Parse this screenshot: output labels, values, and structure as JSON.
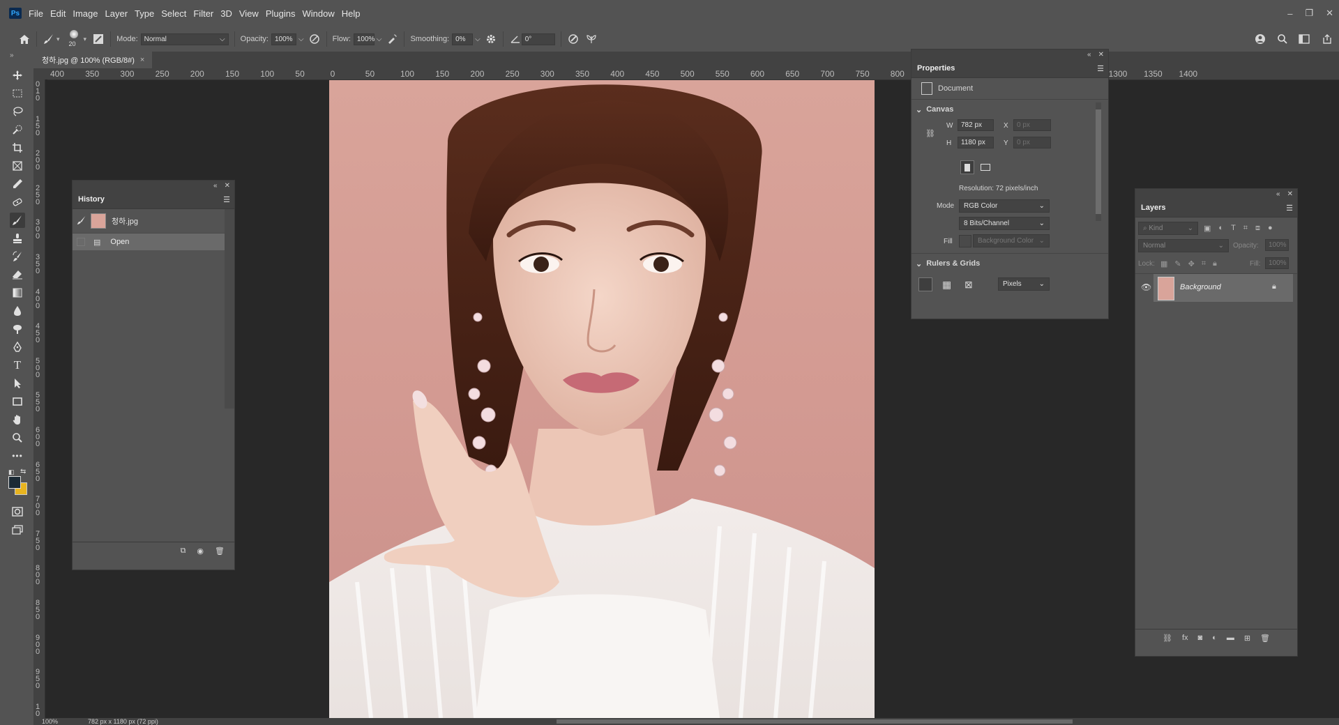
{
  "menubar": {
    "logo": "Ps",
    "items": [
      "File",
      "Edit",
      "Image",
      "Layer",
      "Type",
      "Select",
      "Filter",
      "3D",
      "View",
      "Plugins",
      "Window",
      "Help"
    ],
    "window_controls": [
      "–",
      "❐",
      "✕"
    ]
  },
  "options": {
    "brush_size": "20",
    "mode_label": "Mode:",
    "mode_value": "Normal",
    "opacity_label": "Opacity:",
    "opacity_value": "100%",
    "flow_label": "Flow:",
    "flow_value": "100%",
    "smoothing_label": "Smoothing:",
    "smoothing_value": "0%",
    "angle_value": "0°"
  },
  "document": {
    "tab_title": "청하.jpg @ 100% (RGB/8#)",
    "tab_close": "×"
  },
  "ruler_top": [
    "400",
    "350",
    "300",
    "250",
    "200",
    "150",
    "100",
    "50",
    "0",
    "50",
    "100",
    "150",
    "200",
    "250",
    "300",
    "350",
    "400",
    "450",
    "500",
    "550",
    "600",
    "650",
    "700",
    "750",
    "800",
    "00",
    "1150",
    "1200",
    "1250",
    "1300",
    "1350",
    "1400"
  ],
  "ruler_left": [
    "0",
    "1",
    "0",
    "1",
    "5",
    "0",
    "2",
    "0",
    "0",
    "2",
    "5",
    "0",
    "3",
    "0",
    "0",
    "3",
    "5",
    "0",
    "4",
    "0",
    "0",
    "4",
    "5",
    "0",
    "5",
    "0",
    "0",
    "5",
    "5",
    "0",
    "6",
    "0",
    "0",
    "6",
    "5",
    "0",
    "7",
    "0",
    "0",
    "7",
    "5",
    "0",
    "8",
    "0",
    "0",
    "8",
    "5",
    "0",
    "9",
    "0",
    "0",
    "9",
    "5",
    "0",
    "1",
    "0"
  ],
  "history": {
    "title": "History",
    "snapshot_name": "청하.jpg",
    "steps": [
      "Open"
    ]
  },
  "properties": {
    "title": "Properties",
    "doc_label": "Document",
    "canvas_header": "Canvas",
    "w_label": "W",
    "w_value": "782 px",
    "h_label": "H",
    "h_value": "1180 px",
    "x_label": "X",
    "x_value": "0 px",
    "y_label": "Y",
    "y_value": "0 px",
    "resolution": "Resolution: 72 pixels/inch",
    "mode_label": "Mode",
    "mode_value": "RGB Color",
    "bits_value": "8 Bits/Channel",
    "fill_label": "Fill",
    "fill_value": "Background Color",
    "rulers_header": "Rulers & Grids",
    "units_value": "Pixels"
  },
  "layers": {
    "title": "Layers",
    "filter_placeholder": "Kind",
    "blend_mode": "Normal",
    "opacity_label": "Opacity:",
    "opacity_value": "100%",
    "lock_label": "Lock:",
    "fill_label": "Fill:",
    "fill_value": "100%",
    "layer_name": "Background"
  },
  "status": {
    "zoom": "100%",
    "doc_info": "782 px x 1180 px (72 ppi)"
  },
  "colors": {
    "foreground": "#1b2a35",
    "background": "#e8b41f",
    "ui_panel": "#535353",
    "ui_dark": "#282828"
  }
}
